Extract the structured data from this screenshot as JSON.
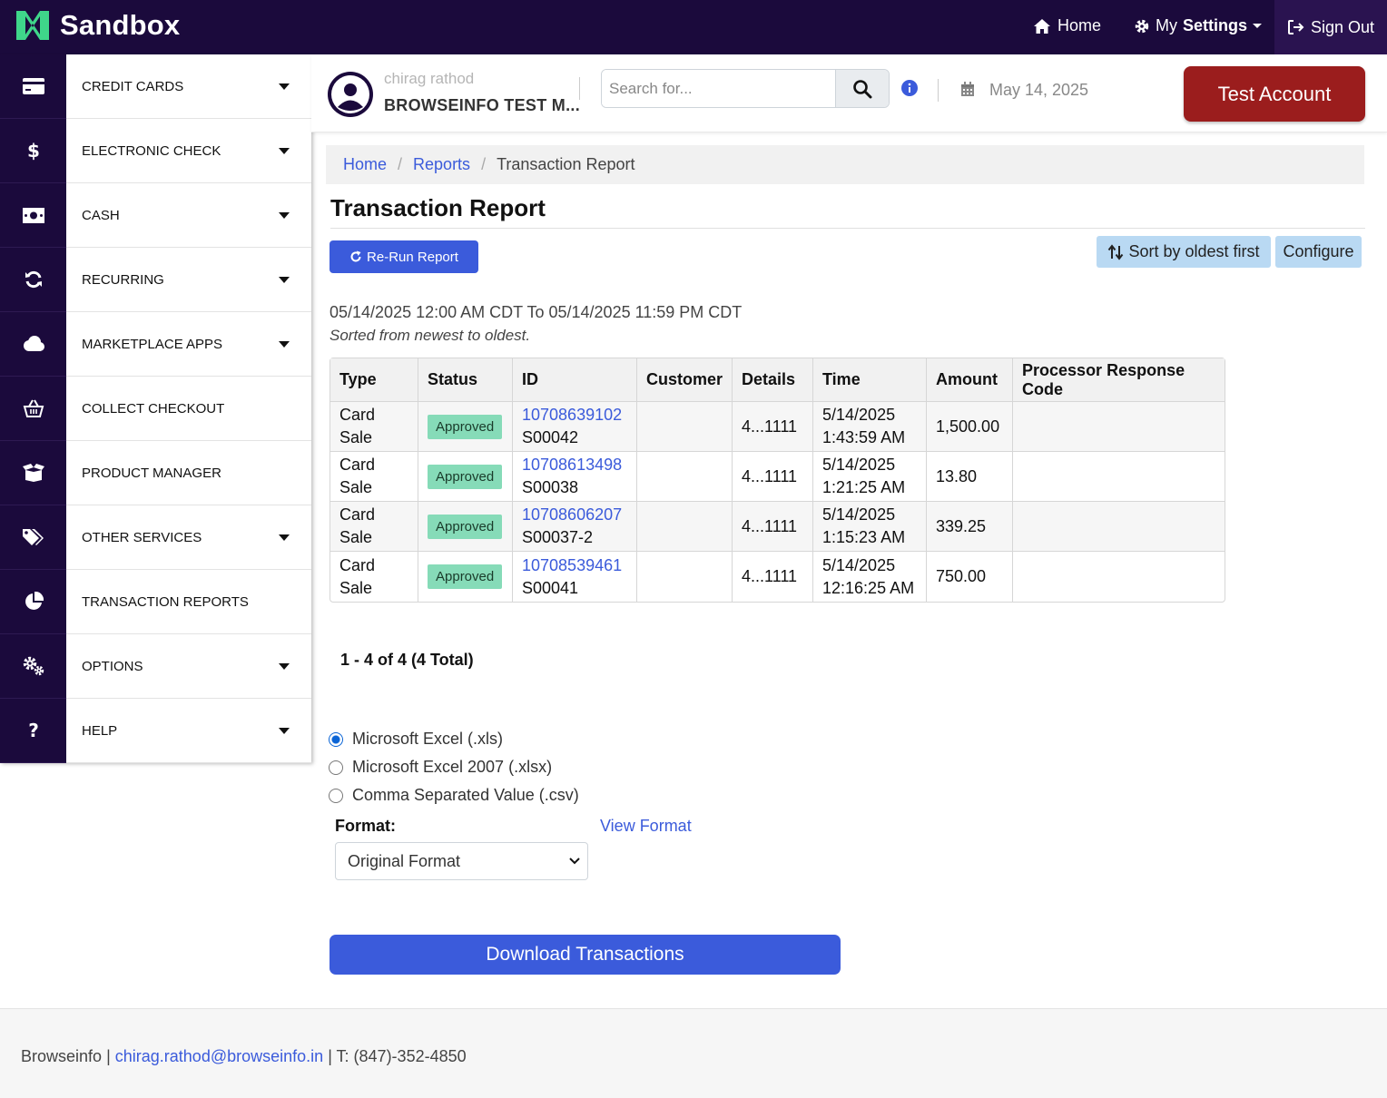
{
  "brand": {
    "name": "Sandbox"
  },
  "topnav": {
    "home": "Home",
    "settings_my": "My",
    "settings_bold": "Settings",
    "signout": "Sign Out"
  },
  "sidebar": {
    "items": [
      {
        "label": "CREDIT CARDS",
        "icon": "credit-card-icon",
        "caret": true
      },
      {
        "label": "ELECTRONIC CHECK",
        "icon": "dollar-icon",
        "caret": true
      },
      {
        "label": "CASH",
        "icon": "money-bill-icon",
        "caret": true
      },
      {
        "label": "RECURRING",
        "icon": "sync-icon",
        "caret": true
      },
      {
        "label": "MARKETPLACE APPS",
        "icon": "cloud-icon",
        "caret": true
      },
      {
        "label": "COLLECT CHECKOUT",
        "icon": "basket-icon",
        "caret": false
      },
      {
        "label": "PRODUCT MANAGER",
        "icon": "box-open-icon",
        "caret": false
      },
      {
        "label": "OTHER SERVICES",
        "icon": "tags-icon",
        "caret": true
      },
      {
        "label": "TRANSACTION REPORTS",
        "icon": "pie-chart-icon",
        "caret": false
      },
      {
        "label": "OPTIONS",
        "icon": "cogs-icon",
        "caret": true
      },
      {
        "label": "HELP",
        "icon": "question-icon",
        "caret": true
      }
    ]
  },
  "header": {
    "user_name": "chirag rathod",
    "merchant": "BROWSEINFO TEST M...",
    "search_placeholder": "Search for...",
    "date": "May 14, 2025",
    "test_account": "Test Account"
  },
  "breadcrumb": {
    "home": "Home",
    "reports": "Reports",
    "current": "Transaction Report"
  },
  "page": {
    "title": "Transaction Report",
    "rerun": "Re-Run Report",
    "sort": "Sort by oldest first",
    "configure": "Configure",
    "range": "05/14/2025 12:00 AM CDT To 05/14/2025 11:59 PM CDT",
    "sorted_note": "Sorted from newest to oldest."
  },
  "table": {
    "headers": [
      "Type",
      "Status",
      "ID",
      "Customer",
      "Details",
      "Time",
      "Amount",
      "Processor Response Code"
    ],
    "rows": [
      {
        "type": "Card Sale",
        "status": "Approved",
        "id": "10708639102",
        "ref": "S00042",
        "customer": "",
        "details": "4...1111",
        "date": "5/14/2025",
        "time": "1:43:59 AM",
        "amount": "1,500.00",
        "code": ""
      },
      {
        "type": "Card Sale",
        "status": "Approved",
        "id": "10708613498",
        "ref": "S00038",
        "customer": "",
        "details": "4...1111",
        "date": "5/14/2025",
        "time": "1:21:25 AM",
        "amount": "13.80",
        "code": ""
      },
      {
        "type": "Card Sale",
        "status": "Approved",
        "id": "10708606207",
        "ref": "S00037-2",
        "customer": "",
        "details": "4...1111",
        "date": "5/14/2025",
        "time": "1:15:23 AM",
        "amount": "339.25",
        "code": ""
      },
      {
        "type": "Card Sale",
        "status": "Approved",
        "id": "10708539461",
        "ref": "S00041",
        "customer": "",
        "details": "4...1111",
        "date": "5/14/2025",
        "time": "12:16:25 AM",
        "amount": "750.00",
        "code": ""
      }
    ]
  },
  "pagination": "1 - 4 of 4 (4 Total)",
  "export": {
    "options": [
      {
        "label": "Microsoft Excel (.xls)",
        "selected": true
      },
      {
        "label": "Microsoft Excel 2007 (.xlsx)",
        "selected": false
      },
      {
        "label": "Comma Separated Value (.csv)",
        "selected": false
      }
    ],
    "format_label": "Format:",
    "view_format": "View Format",
    "format_value": "Original Format",
    "download": "Download Transactions"
  },
  "footer": {
    "company": "Browseinfo",
    "sep1": "|",
    "email": "chirag.rathod@browseinfo.in",
    "phone": "| T: (847)-352-4850"
  },
  "colors": {
    "nav_bg": "#1b0a3c",
    "primary": "#3b5bdb",
    "danger": "#9b1d1d",
    "approved": "#86dbb8",
    "info_btn": "#b9d9f3"
  }
}
